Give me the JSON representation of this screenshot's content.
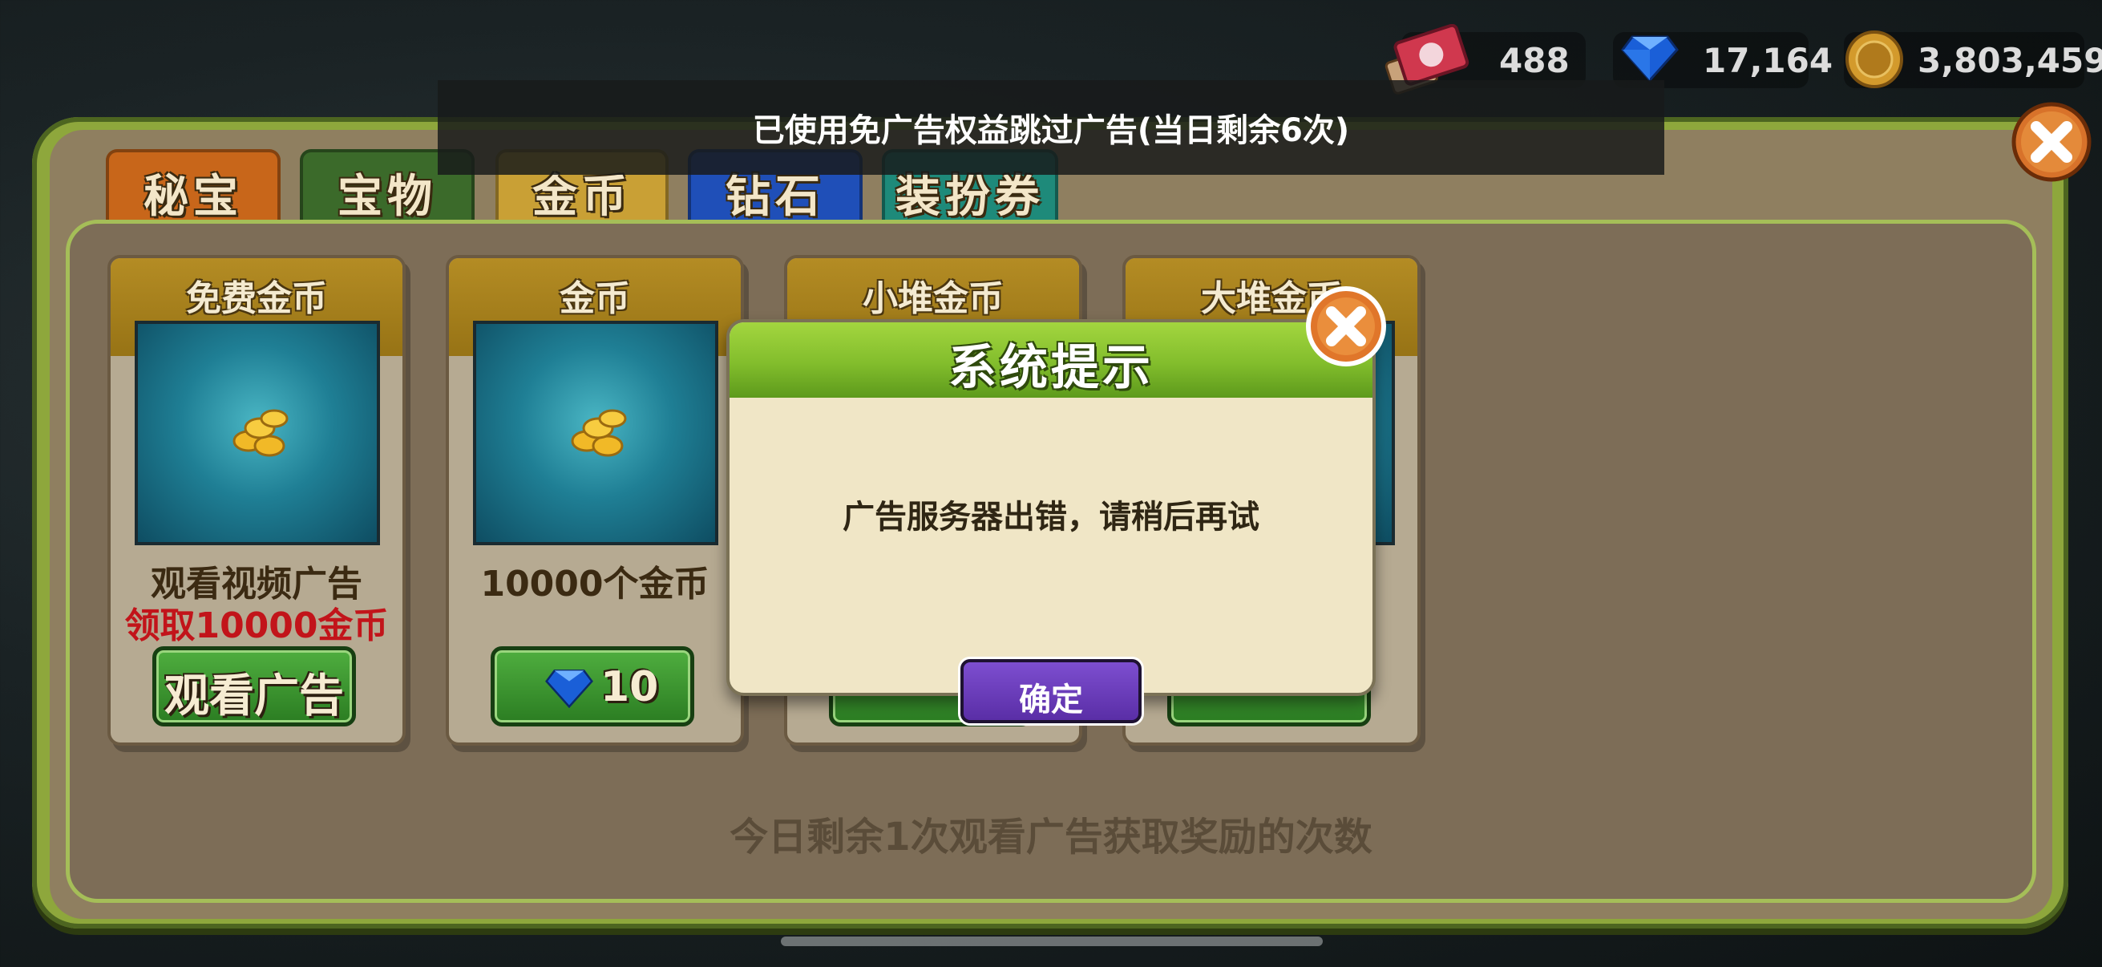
{
  "hud": {
    "tickets": "488",
    "gems": "17,164",
    "coins": "3,803,459",
    "icons": [
      "ticket-icon",
      "gem-icon",
      "coin-icon"
    ]
  },
  "toast": {
    "text": "已使用免广告权益跳过广告(当日剩余6次)"
  },
  "tabs": [
    {
      "label": "秘宝",
      "color": "#c8661a"
    },
    {
      "label": "宝物",
      "color": "#3b6a2a"
    },
    {
      "label": "金币",
      "color": "#c9a035"
    },
    {
      "label": "钻石",
      "color": "#1f4fb8"
    },
    {
      "label": "装扮券",
      "color": "#1e8a7a"
    }
  ],
  "cards": [
    {
      "title": "免费金币",
      "desc": "观看视频广告",
      "desc2": "领取10000金币",
      "button": "观看广告"
    },
    {
      "title": "金币",
      "desc": "10000个金币",
      "price": "10"
    },
    {
      "title": "小堆金币"
    },
    {
      "title": "大堆金币"
    }
  ],
  "bottom_note": "今日剩余1次观看广告获取奖励的次数",
  "dialog": {
    "title": "系统提示",
    "message": "广告服务器出错，请稍后再试",
    "ok_label": "确定"
  },
  "colors": {
    "frame_green": "#8ea73c",
    "panel_brown": "#7d6d57",
    "ok_purple": "#6a3cbc",
    "price_red": "#c2141a"
  }
}
